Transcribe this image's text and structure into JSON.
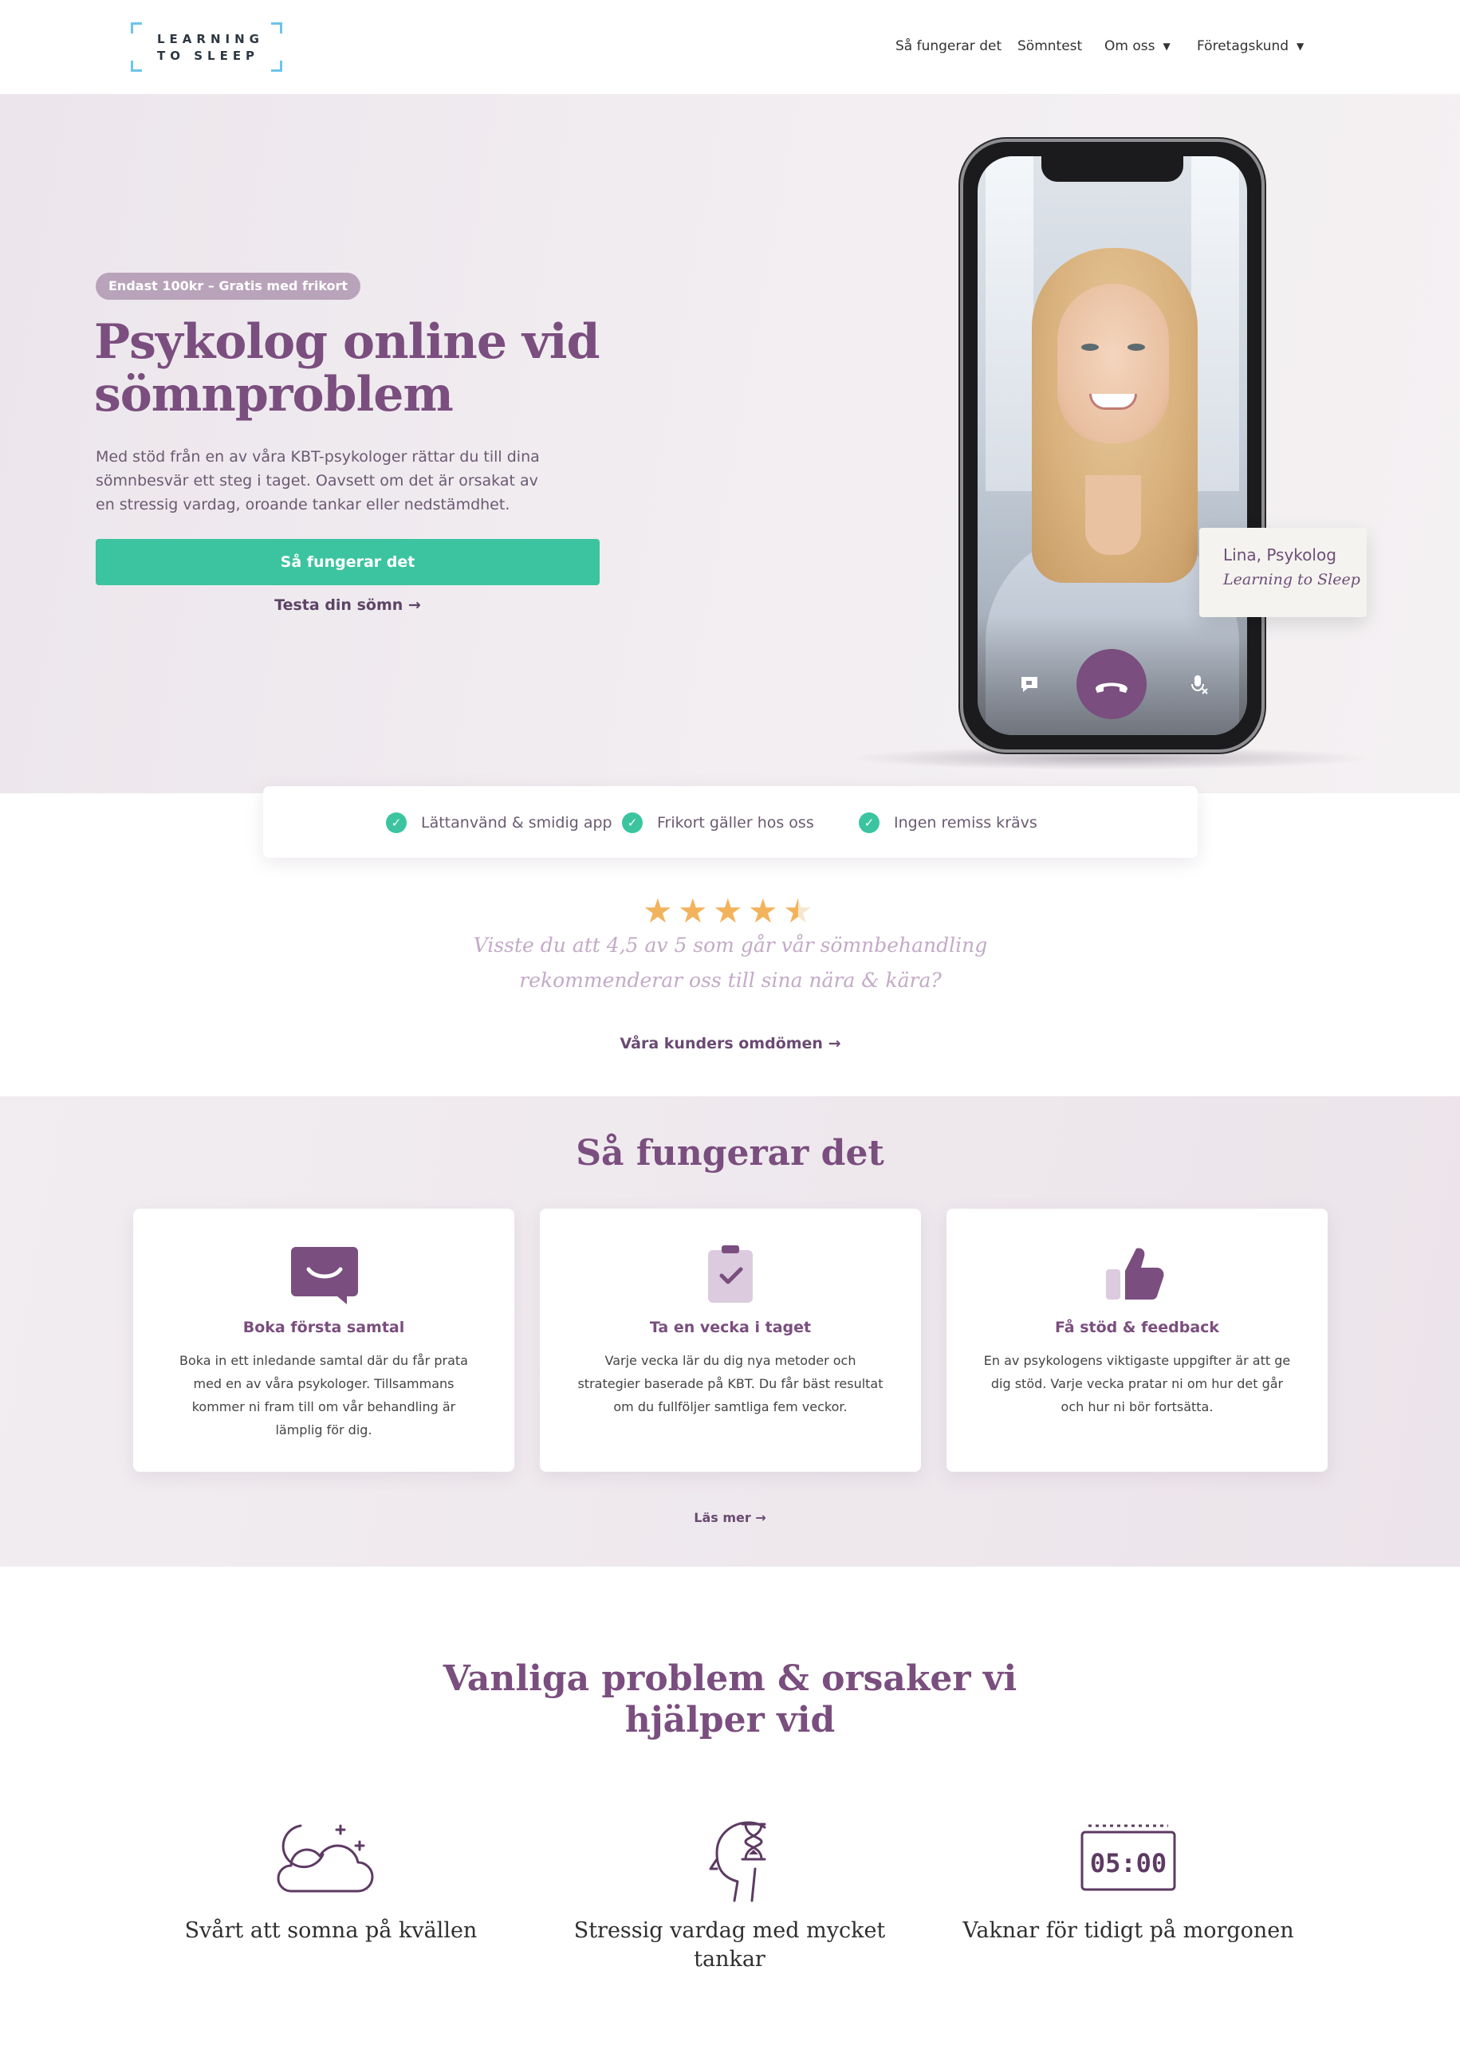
{
  "header": {
    "logo": {
      "line1": "LEARNING",
      "line2": "TO SLEEP"
    },
    "nav": [
      {
        "label": "Så fungerar det",
        "has_caret": false
      },
      {
        "label": "Sömntest",
        "has_caret": false
      },
      {
        "label": "Om oss",
        "has_caret": true
      },
      {
        "label": "Företagskund",
        "has_caret": true
      }
    ]
  },
  "hero": {
    "badge": "Endast 100kr – Gratis med frikort",
    "title": "Psykolog online vid sömnproblem",
    "text": "Med stöd från en av våra KBT-psykologer rättar du till dina sömnbesvär ett steg i taget. Oavsett om det är orsakat av en stressig vardag, oroande tankar eller nedstämdhet.",
    "cta_label": "Så fungerar det",
    "secondary_link": "Testa din sömn →",
    "name_card": {
      "name": "Lina, Psykolog",
      "signature": "Learning to Sleep"
    }
  },
  "features": [
    "Lättanvänd & smidig app",
    "Frikort gäller hos oss",
    "Ingen remiss krävs"
  ],
  "rating": {
    "stars": 4.5,
    "quote_line1": "Visste du att 4,5 av 5 som går vår sömnbehandling",
    "quote_line2": "rekommenderar oss till sina nära & kära?",
    "reviews_link": "Våra kunders omdömen →"
  },
  "how_it_works": {
    "title": "Så fungerar det",
    "cards": [
      {
        "icon": "chat-smile-icon",
        "title": "Boka första samtal",
        "text": "Boka in ett inledande samtal där du får prata med en av våra psykologer. Tillsammans kommer ni fram till om vår behandling är lämplig för dig."
      },
      {
        "icon": "clipboard-check-icon",
        "title": "Ta en vecka i taget",
        "text": "Varje vecka lär du dig nya metoder och strategier baserade på KBT. Du får bäst resultat om du fullföljer samtliga fem veckor."
      },
      {
        "icon": "thumbs-up-icon",
        "title": "Få stöd & feedback",
        "text": "En av psykologens viktigaste uppgifter är att ge dig stöd. Varje vecka pratar ni om hur det går och hur ni bör fortsätta."
      }
    ],
    "more_link": "Läs mer →"
  },
  "problems": {
    "title_line1": "Vanliga problem & orsaker vi",
    "title_line2": "hjälper vid",
    "items": [
      {
        "icon": "moon-cloud-icon",
        "label": "Svårt att somna på kvällen"
      },
      {
        "icon": "head-hourglass-icon",
        "label": "Stressig vardag med mycket tankar"
      },
      {
        "icon": "alarm-clock-icon",
        "label": "Vaknar för tidigt på morgonen",
        "clock_text": "05:00"
      }
    ]
  },
  "colors": {
    "brand_purple": "#7a4e7e",
    "accent_green": "#3bc49f",
    "star": "#f2b35c",
    "logo_bracket": "#6cc4ea"
  }
}
